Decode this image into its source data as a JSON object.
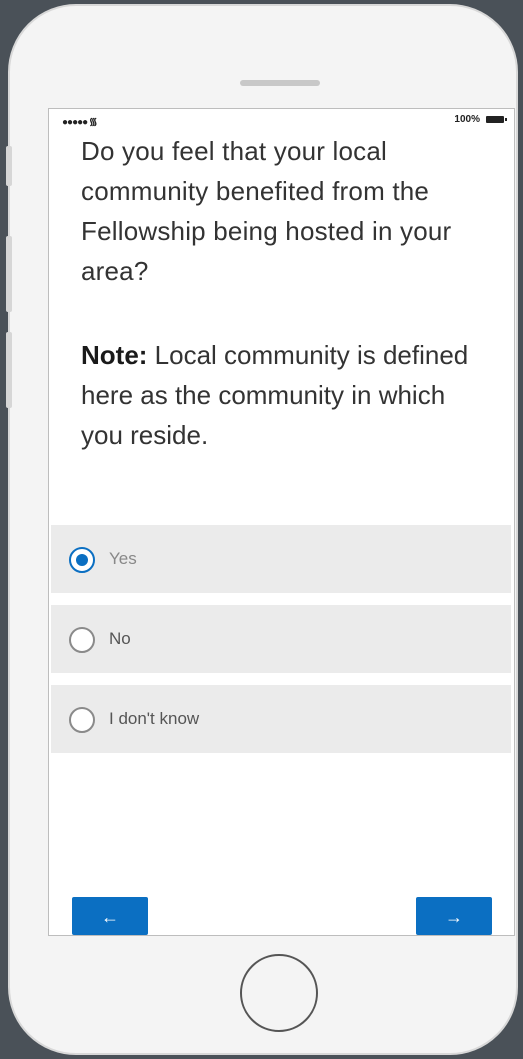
{
  "status_bar": {
    "signal": "●●●●● ",
    "wifi_icon": "wifi-icon",
    "battery_percent": "100%",
    "battery_icon": "battery-icon"
  },
  "survey": {
    "question": "Do you feel that your local community benefited from the Fellowship being hosted in your area?",
    "note_label": "Note:",
    "note_text": " Local community is defined here as the community in which you reside.",
    "options": [
      {
        "label": "Yes",
        "selected": true
      },
      {
        "label": "No",
        "selected": false
      },
      {
        "label": "I don't know",
        "selected": false
      }
    ]
  },
  "navigation": {
    "back_label": "←",
    "next_label": "→"
  },
  "colors": {
    "accent": "#0b6fc2",
    "option_bg": "#ebebeb",
    "background": "#4a5158"
  }
}
